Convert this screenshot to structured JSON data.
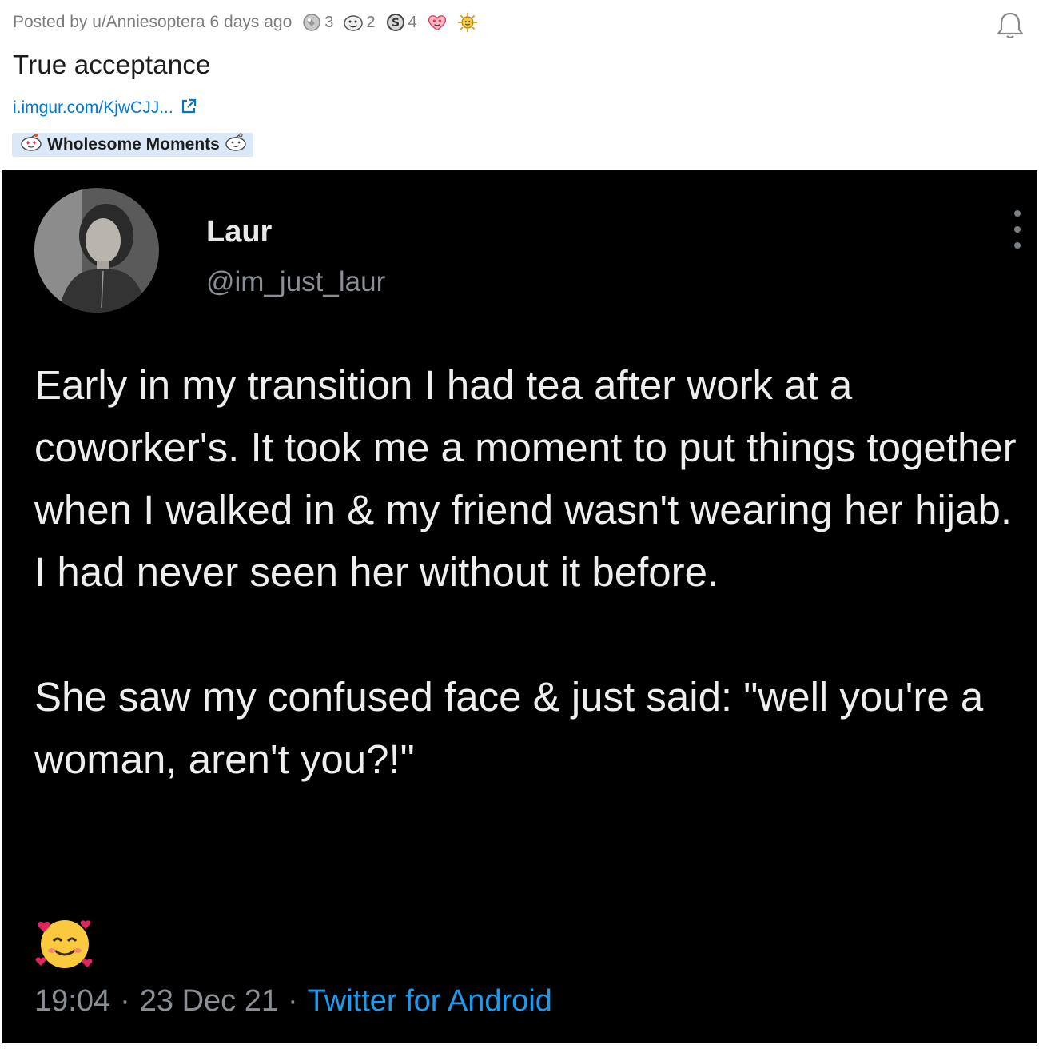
{
  "post": {
    "posted_by": "Posted by u/Anniesoptera",
    "age": "6 days ago",
    "awards": [
      {
        "icon": "silver-award-icon",
        "count": "3"
      },
      {
        "icon": "helpful-award-icon",
        "count": "2"
      },
      {
        "icon": "s-coin-award-icon",
        "count": "4"
      },
      {
        "icon": "heart-eyes-award-icon",
        "count": ""
      },
      {
        "icon": "sun-award-icon",
        "count": ""
      }
    ],
    "title": "True acceptance",
    "link": "i.imgur.com/KjwCJJ...",
    "flair": "Wholesome Moments"
  },
  "tweet": {
    "name": "Laur",
    "handle": "@im_just_laur",
    "paragraph1": "Early in my transition I had tea after work at a coworker's. It took me a moment to put things together when I walked in & my friend wasn't wearing her hijab. I had never seen her without it before.",
    "paragraph2": "She saw my confused face & just said: \"well you're a woman, aren't you?!\"",
    "time": "19:04",
    "date": "23 Dec 21",
    "separator": "·",
    "source": "Twitter for Android"
  },
  "colors": {
    "link": "#0079d3",
    "twitter_blue": "#1d9bf0",
    "tweet_bg": "#000000",
    "flair_bg": "#dbe8f7"
  }
}
